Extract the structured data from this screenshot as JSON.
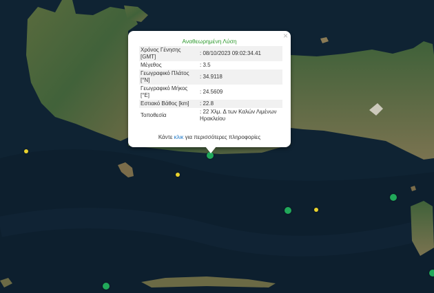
{
  "map": {
    "colors": {
      "sea": "#0f2333",
      "land_green": "#45653a",
      "land_tan": "#8a7a55"
    },
    "markers": [
      {
        "color": "green",
        "magnitude_hint": "larger"
      },
      {
        "color": "green",
        "magnitude_hint": "larger"
      },
      {
        "color": "green",
        "magnitude_hint": "larger"
      },
      {
        "color": "green",
        "magnitude_hint": "larger"
      },
      {
        "color": "green",
        "magnitude_hint": "larger"
      },
      {
        "color": "yellow",
        "magnitude_hint": "smaller"
      },
      {
        "color": "yellow",
        "magnitude_hint": "smaller"
      },
      {
        "color": "yellow",
        "magnitude_hint": "smaller"
      }
    ]
  },
  "popup": {
    "title": "Αναθεωρημένη Λύση",
    "close_icon": "close-icon",
    "rows": [
      {
        "label": "Χρόνος Γένησης [GMT]",
        "value": ": 08/10/2023 09:02:34.41"
      },
      {
        "label": "Μέγεθος",
        "value": ": 3.5"
      },
      {
        "label": "Γεωγραφικό Πλάτος [°N]",
        "value": ": 34.9118"
      },
      {
        "label": "Γεωγραφικό Μήκος [°E]",
        "value": ": 24.5609"
      },
      {
        "label": "Εστιακό Βάθος [km]",
        "value": ": 22.8"
      },
      {
        "label": "Τοποθεσία",
        "value": ": 22 Χλμ. Δ των Καλών Λιμένων Ηρακλείου"
      }
    ],
    "more_prefix": "Κάντε",
    "more_link": "κλικ",
    "more_suffix": "για περισσότερες πληροφορίες"
  }
}
